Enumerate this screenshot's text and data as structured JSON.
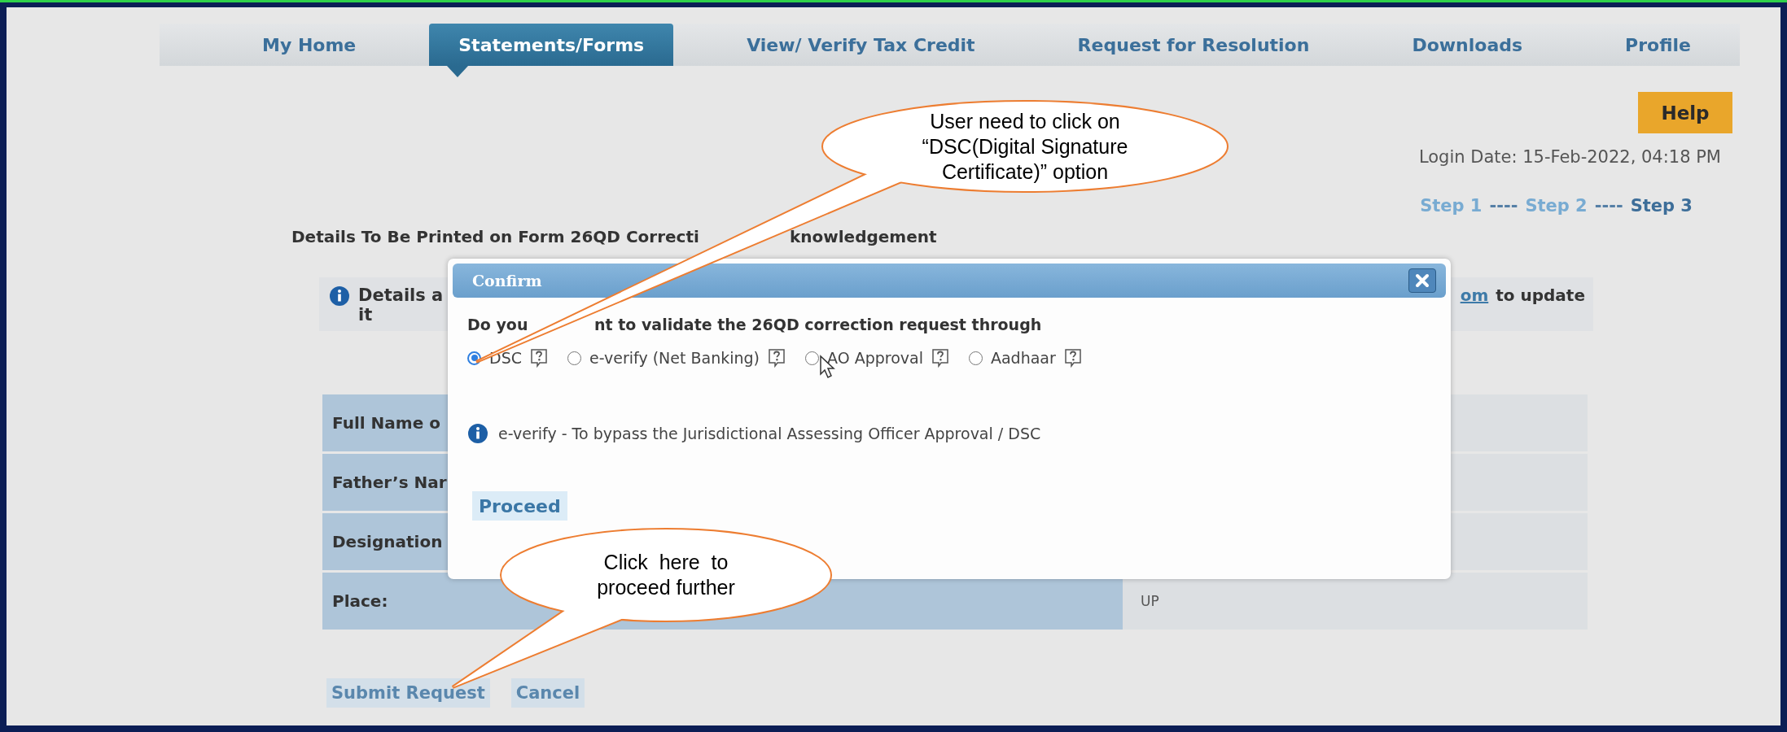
{
  "nav_tabs": [
    {
      "label": "My Home",
      "selected": false
    },
    {
      "label": "Statements/Forms",
      "selected": true
    },
    {
      "label": "View/ Verify Tax Credit",
      "selected": false
    },
    {
      "label": "Request for Resolution",
      "selected": false
    },
    {
      "label": "Downloads",
      "selected": false
    },
    {
      "label": "Profile",
      "selected": false
    }
  ],
  "help_button": "Help",
  "login_date": "Login Date: 15-Feb-2022, 04:18 PM",
  "steps": [
    {
      "label": "Step 1",
      "selected": false,
      "separator_after": "----"
    },
    {
      "label": "Step 2",
      "selected": false,
      "separator_after": "----"
    },
    {
      "label": "Step 3",
      "selected": true
    }
  ],
  "heading": {
    "start": "Details To Be Printed on Form 26QD Correcti",
    "end": "knowledgement"
  },
  "notice": {
    "line_1_start": "Details a",
    "line_2_start": "it",
    "link": "om",
    "line_1_end": "to update"
  },
  "table": {
    "rows": [
      {
        "label": "Full Name o"
      },
      {
        "label": "Father’s Nar"
      },
      {
        "label": "Designation"
      },
      {
        "label": "Place:",
        "value": "UP"
      }
    ]
  },
  "buttons": [
    "Submit Request",
    "Cancel"
  ],
  "dialog": {
    "title": "Confirm",
    "question_start": "Do you",
    "question_end": "nt to validate the 26QD correction request through",
    "options": [
      {
        "label": "DSC",
        "selected": true
      },
      {
        "label": "e-verify (Net Banking)",
        "selected": false
      },
      {
        "label": "AO Approval",
        "selected": false
      },
      {
        "label": "Aadhaar",
        "selected": false
      }
    ],
    "info": "e-verify - To bypass the Jurisdictional Assessing Officer Approval / DSC",
    "proceed_button": "Proceed"
  },
  "callouts": [
    {
      "text": "User need to click on “DSC(Digital Signature Certificate)” option"
    },
    {
      "text": "Click  here  to proceed further"
    }
  ]
}
